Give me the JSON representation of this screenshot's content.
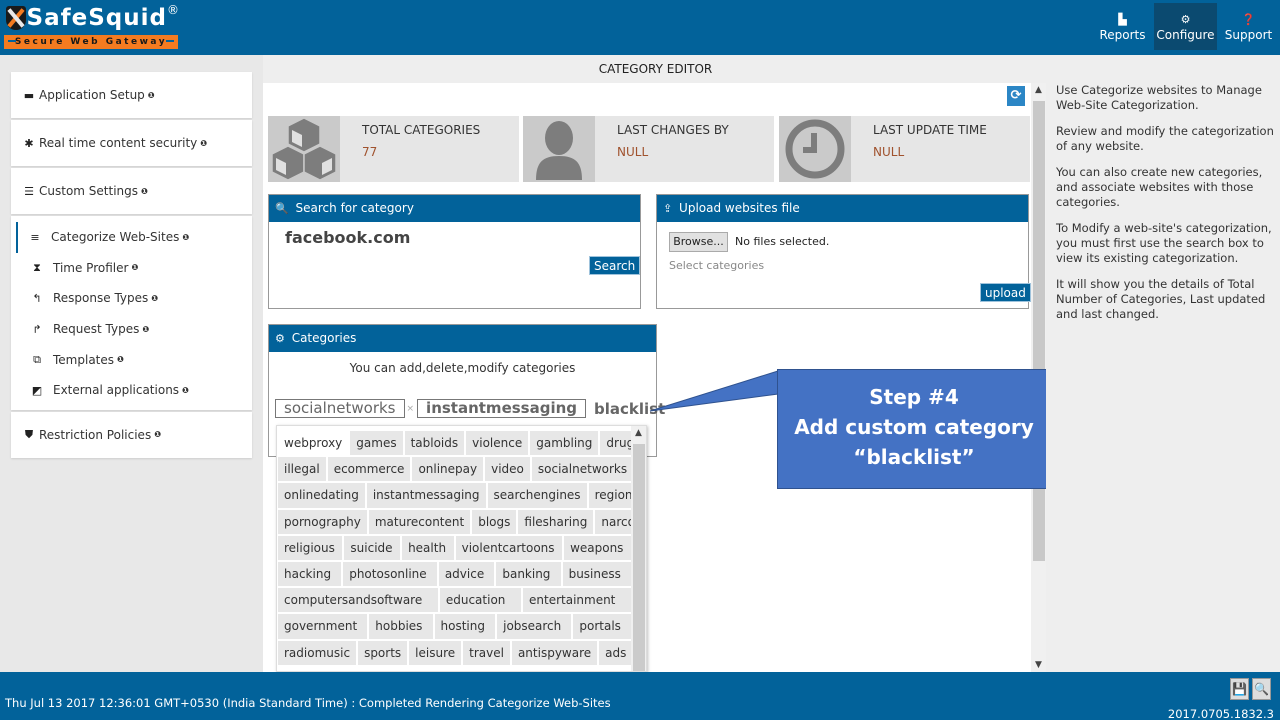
{
  "brand": {
    "name": "SafeSquid",
    "registered": "®",
    "tagline": "Secure Web Gateway"
  },
  "topnav": [
    {
      "label": "Reports",
      "icon": "area-chart-icon",
      "glyph": "▙",
      "active": false
    },
    {
      "label": "Configure",
      "icon": "cogs-icon",
      "glyph": "⚙",
      "active": true
    },
    {
      "label": "Support",
      "icon": "question-circle-icon",
      "glyph": "❓",
      "active": false
    }
  ],
  "sidebar": {
    "info_glyph": "❶",
    "application_setup": {
      "label": "Application Setup",
      "icon": "briefcase-icon",
      "glyph": "▬"
    },
    "realtime_security": {
      "label": "Real time content security",
      "icon": "bug-icon",
      "glyph": "✱"
    },
    "custom_settings": {
      "label": "Custom Settings",
      "icon": "sliders-icon",
      "glyph": "☰"
    },
    "custom_items": [
      {
        "label": "Categorize Web-Sites",
        "icon": "database-icon",
        "glyph": "≡",
        "active": true
      },
      {
        "label": "Time Profiler",
        "icon": "hourglass-icon",
        "glyph": "⧗",
        "active": false
      },
      {
        "label": "Response Types",
        "icon": "reply-icon",
        "glyph": "↰",
        "active": false
      },
      {
        "label": "Request Types",
        "icon": "share-icon",
        "glyph": "↱",
        "active": false
      },
      {
        "label": "Templates",
        "icon": "object-group-icon",
        "glyph": "⧉",
        "active": false
      },
      {
        "label": "External applications",
        "icon": "external-link-icon",
        "glyph": "◩",
        "active": false
      }
    ],
    "restriction_policies": {
      "label": "Restriction Policies",
      "icon": "shield-icon",
      "glyph": "⛊"
    }
  },
  "main": {
    "title": "CATEGORY EDITOR",
    "refresh_glyph": "⟳",
    "stats": [
      {
        "label": "TOTAL CATEGORIES",
        "value": "77",
        "icon": "cubes-icon"
      },
      {
        "label": "LAST CHANGES BY",
        "value": "NULL",
        "icon": "user-icon"
      },
      {
        "label": "LAST UPDATE TIME",
        "value": "NULL",
        "icon": "clock-icon"
      }
    ],
    "search_panel": {
      "title": "Search for category",
      "icon_glyph": "🔍",
      "value": "facebook.com",
      "button": "Search"
    },
    "upload_panel": {
      "title": "Upload websites file",
      "icon_glyph": "⇪",
      "browse_button": "Browse...",
      "file_status": "No files selected.",
      "select_placeholder": "Select categories",
      "button": "upload"
    },
    "categories_panel": {
      "title": "Categories",
      "icon_glyph": "⚙",
      "description": "You can add,delete,modify categories",
      "selected_tags": [
        "socialnetworks",
        "instantmessaging"
      ],
      "remove_glyph": "×",
      "typed_value": "blacklist",
      "options": [
        "webproxy",
        "games",
        "tabloids",
        "violence",
        "gambling",
        "drugs",
        "illegal",
        "ecommerce",
        "onlinepay",
        "video",
        "socialnetworks",
        "onlinedating",
        "instantmessaging",
        "searchengines",
        "regionaltlds",
        "pornography",
        "maturecontent",
        "blogs",
        "filesharing",
        "narcotics",
        "religious",
        "suicide",
        "health",
        "violentcartoons",
        "weapons",
        "hacking",
        "photosonline",
        "advice",
        "banking",
        "business",
        "computersandsoftware",
        "education",
        "entertainment",
        "government",
        "hobbies",
        "hosting",
        "jobsearch",
        "portals",
        "radiomusic",
        "sports",
        "leisure",
        "travel",
        "antispyware",
        "ads"
      ],
      "option_rows": [
        6,
        5,
        4,
        5,
        5,
        5,
        3,
        5,
        6
      ]
    }
  },
  "callout": {
    "line1": "Step #4",
    "line2": "Add custom category",
    "line3": "“blacklist”"
  },
  "help": [
    "Use Categorize websites to Manage Web-Site Categorization.",
    "Review and modify the categorization of any website.",
    "You can also create new categories, and associate websites with those categories.",
    "To Modify a web-site's categorization, you must first use the search box to view its existing categorization.",
    "It will show you the details of Total Number of Categories, Last updated and last changed."
  ],
  "footer": {
    "status": "Thu Jul 13 2017 12:36:01 GMT+0530 (India Standard Time) : Completed Rendering Categorize Web-Sites",
    "version": "2017.0705.1832.3",
    "save_glyph": "💾",
    "search_glyph": "🔍"
  },
  "colors": {
    "brand_blue": "#02629a",
    "brand_orange": "#f47b20",
    "callout_blue": "#4472c4",
    "stat_value": "#a0522d"
  }
}
